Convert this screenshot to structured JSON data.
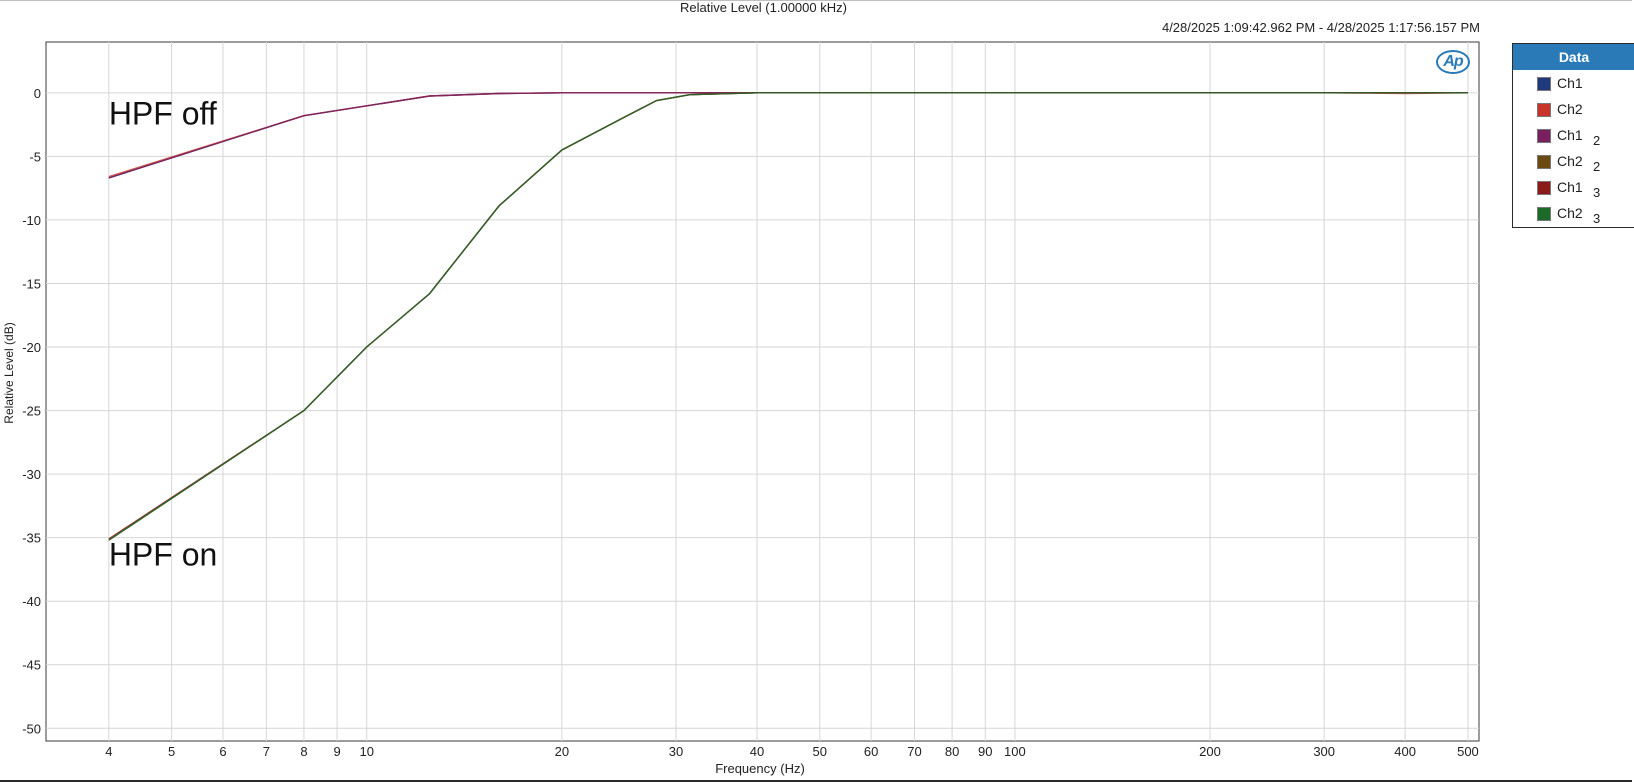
{
  "chart_data": {
    "type": "line",
    "title": "Relative Level (1.00000 kHz)",
    "subtitle": "4/28/2025 1:09:42.962 PM - 4/28/2025 1:17:56.157 PM",
    "xlabel": "Frequency (Hz)",
    "ylabel": "Relative Level (dB)",
    "xscale": "log",
    "xlim": [
      3.2,
      520
    ],
    "ylim": [
      -51,
      4
    ],
    "grid": true,
    "xticks": [
      4,
      5,
      6,
      7,
      8,
      9,
      10,
      20,
      30,
      40,
      50,
      60,
      70,
      80,
      90,
      100,
      200,
      300,
      400,
      500
    ],
    "yticks": [
      0,
      -5,
      -10,
      -15,
      -20,
      -25,
      -30,
      -35,
      -40,
      -45,
      -50
    ],
    "legend_position": "right",
    "annotations": [
      {
        "text": "HPF off",
        "x": 4,
        "y": -2.5
      },
      {
        "text": "HPF on",
        "x": 4,
        "y": -37.2
      }
    ],
    "series": [
      {
        "name": "Ch1",
        "color": "#1f3a7a",
        "x": [
          4,
          8,
          12.5,
          16,
          20,
          25,
          31.5,
          40,
          50,
          60,
          100,
          200,
          300,
          400,
          500
        ],
        "y": [
          -6.7,
          -1.8,
          -0.25,
          -0.05,
          0,
          0,
          0,
          0,
          0,
          0,
          0,
          0,
          0,
          0,
          0
        ]
      },
      {
        "name": "Ch2",
        "color": "#c8342b",
        "x": [
          4,
          8,
          12.5,
          16,
          20,
          25,
          31.5,
          40,
          50,
          60,
          100,
          200,
          300,
          400,
          500
        ],
        "y": [
          -6.6,
          -1.8,
          -0.25,
          -0.05,
          0,
          0,
          0,
          0,
          0,
          0,
          0,
          0,
          0,
          -0.05,
          0
        ]
      },
      {
        "name": "Ch1 2",
        "color": "#7a2060",
        "x": [
          4,
          8,
          12.5,
          16,
          20,
          25,
          31.5,
          40,
          50,
          60,
          100,
          200,
          300,
          400,
          500
        ],
        "y": [
          -6.7,
          -1.8,
          -0.25,
          -0.05,
          0,
          0,
          0,
          0,
          0,
          0,
          0,
          0,
          0,
          0,
          0
        ]
      },
      {
        "name": "Ch2 2",
        "color": "#6b4a12",
        "x": [
          4,
          8,
          10,
          12.5,
          16,
          20,
          25,
          28,
          31.5,
          40,
          50,
          60,
          100,
          200,
          300,
          400,
          500
        ],
        "y": [
          -35.2,
          -25,
          -20,
          -15.8,
          -8.9,
          -4.5,
          -1.9,
          -0.6,
          -0.15,
          0,
          0,
          0,
          0,
          0,
          0,
          0,
          0
        ]
      },
      {
        "name": "Ch1 3",
        "color": "#8b1a1a",
        "x": [
          4,
          8,
          10,
          12.5,
          16,
          20,
          25,
          28,
          31.5,
          40,
          50,
          60,
          100,
          200,
          300,
          400,
          500
        ],
        "y": [
          -35.1,
          -25,
          -20,
          -15.8,
          -8.9,
          -4.5,
          -1.9,
          -0.6,
          -0.15,
          0,
          0,
          0,
          0,
          0,
          0,
          0,
          0
        ]
      },
      {
        "name": "Ch2 3",
        "color": "#1d6b2a",
        "x": [
          4,
          8,
          10,
          12.5,
          16,
          20,
          25,
          28,
          31.5,
          40,
          50,
          60,
          100,
          200,
          300,
          400,
          500
        ],
        "y": [
          -35.2,
          -25,
          -20,
          -15.8,
          -8.9,
          -4.5,
          -1.9,
          -0.6,
          -0.15,
          0,
          0,
          0,
          0,
          0,
          0,
          0,
          0
        ]
      }
    ]
  },
  "legend": {
    "title": "Data",
    "items": [
      {
        "label": "Ch1",
        "sub": "",
        "color": "#1f3a7a"
      },
      {
        "label": "Ch2",
        "sub": "",
        "color": "#c8342b"
      },
      {
        "label": "Ch1",
        "sub": "2",
        "color": "#7a2060"
      },
      {
        "label": "Ch2",
        "sub": "2",
        "color": "#6b4a12"
      },
      {
        "label": "Ch1",
        "sub": "3",
        "color": "#8b1a1a"
      },
      {
        "label": "Ch2",
        "sub": "3",
        "color": "#1d6b2a"
      }
    ]
  },
  "logo": {
    "text": "Ap"
  }
}
